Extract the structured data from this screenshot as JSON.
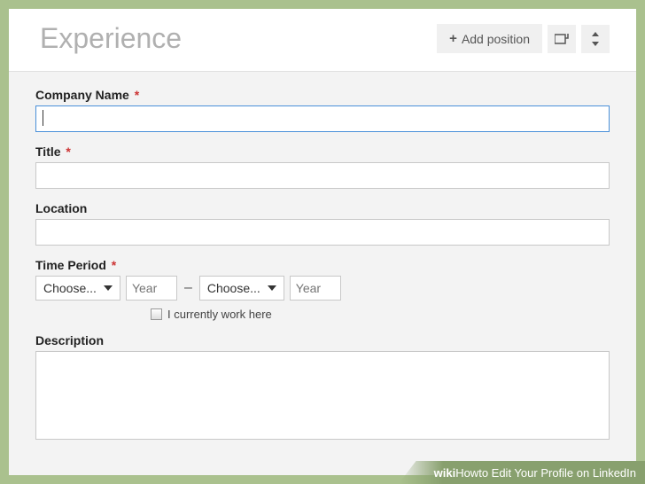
{
  "header": {
    "title": "Experience",
    "add_label": "Add position"
  },
  "form": {
    "company": {
      "label": "Company Name",
      "required": "*",
      "value": ""
    },
    "title": {
      "label": "Title",
      "required": "*",
      "value": ""
    },
    "location": {
      "label": "Location",
      "value": ""
    },
    "time_period": {
      "label": "Time Period",
      "required": "*",
      "choose_label": "Choose...",
      "year_placeholder": "Year",
      "separator": "–",
      "current_checkbox_label": "I currently work here"
    },
    "description": {
      "label": "Description",
      "value": ""
    }
  },
  "caption": {
    "brand_bold": "wiki",
    "brand_rest": "How",
    "article": " to Edit Your Profile on LinkedIn"
  }
}
